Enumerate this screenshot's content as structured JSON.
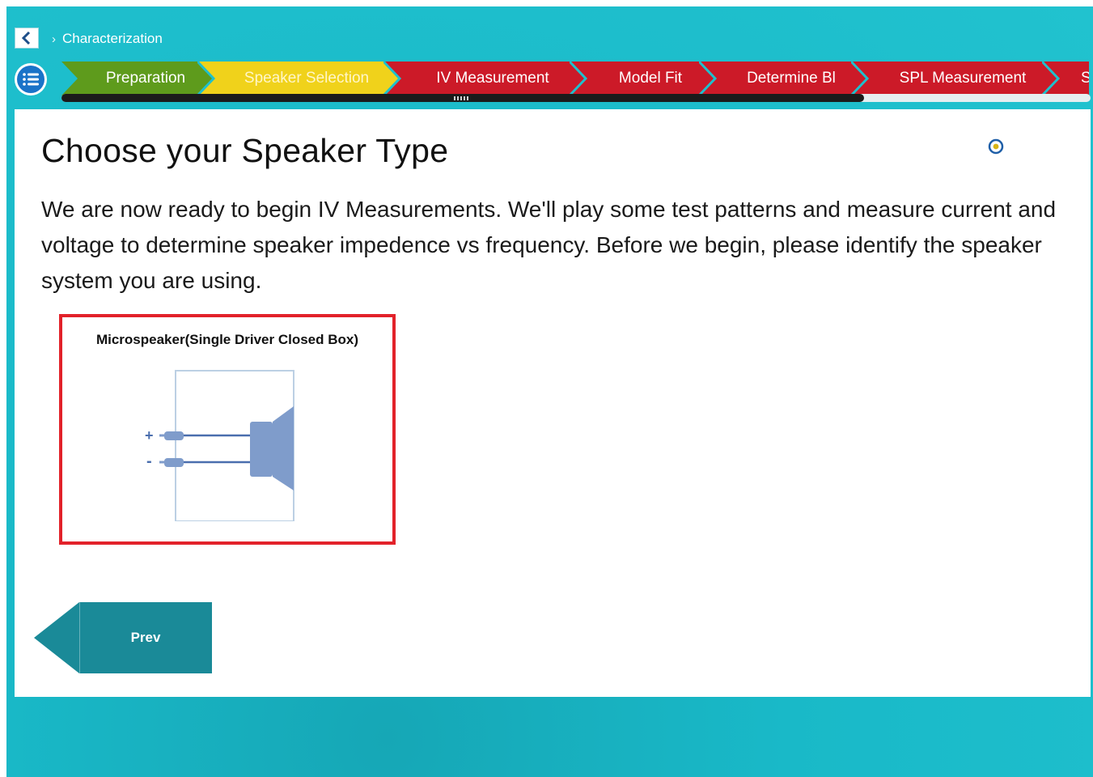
{
  "breadcrumb": {
    "back_icon": "chevron-left-icon",
    "separator": "›",
    "current": "Characterization"
  },
  "menu": {
    "icon": "list-icon"
  },
  "steps": [
    {
      "label": "Preparation",
      "state": "done"
    },
    {
      "label": "Speaker Selection",
      "state": "current"
    },
    {
      "label": "IV Measurement",
      "state": "todo"
    },
    {
      "label": "Model Fit",
      "state": "todo"
    },
    {
      "label": "Determine Bl",
      "state": "todo"
    },
    {
      "label": "SPL Measurement",
      "state": "todo"
    },
    {
      "label": "S",
      "state": "todo"
    }
  ],
  "progress": {
    "fraction": 0.78
  },
  "main": {
    "title": "Choose your Speaker Type",
    "info_icon": "target-icon",
    "description": "We are now ready to begin IV Measurements. We'll play some test patterns and measure current and voltage to determine speaker impedence vs frequency. Before we begin, please identify the speaker system you are using."
  },
  "speaker_option": {
    "title": "Microspeaker(Single Driver Closed Box)",
    "plus": "+",
    "minus": "-"
  },
  "nav": {
    "prev_label": "Prev"
  },
  "colors": {
    "accent": "#1aa9b8",
    "step_done": "#5e9b1c",
    "step_current": "#f0d21b",
    "step_todo": "#cc1a28",
    "selection_border": "#e2222a",
    "prev_button": "#1a8a98"
  }
}
